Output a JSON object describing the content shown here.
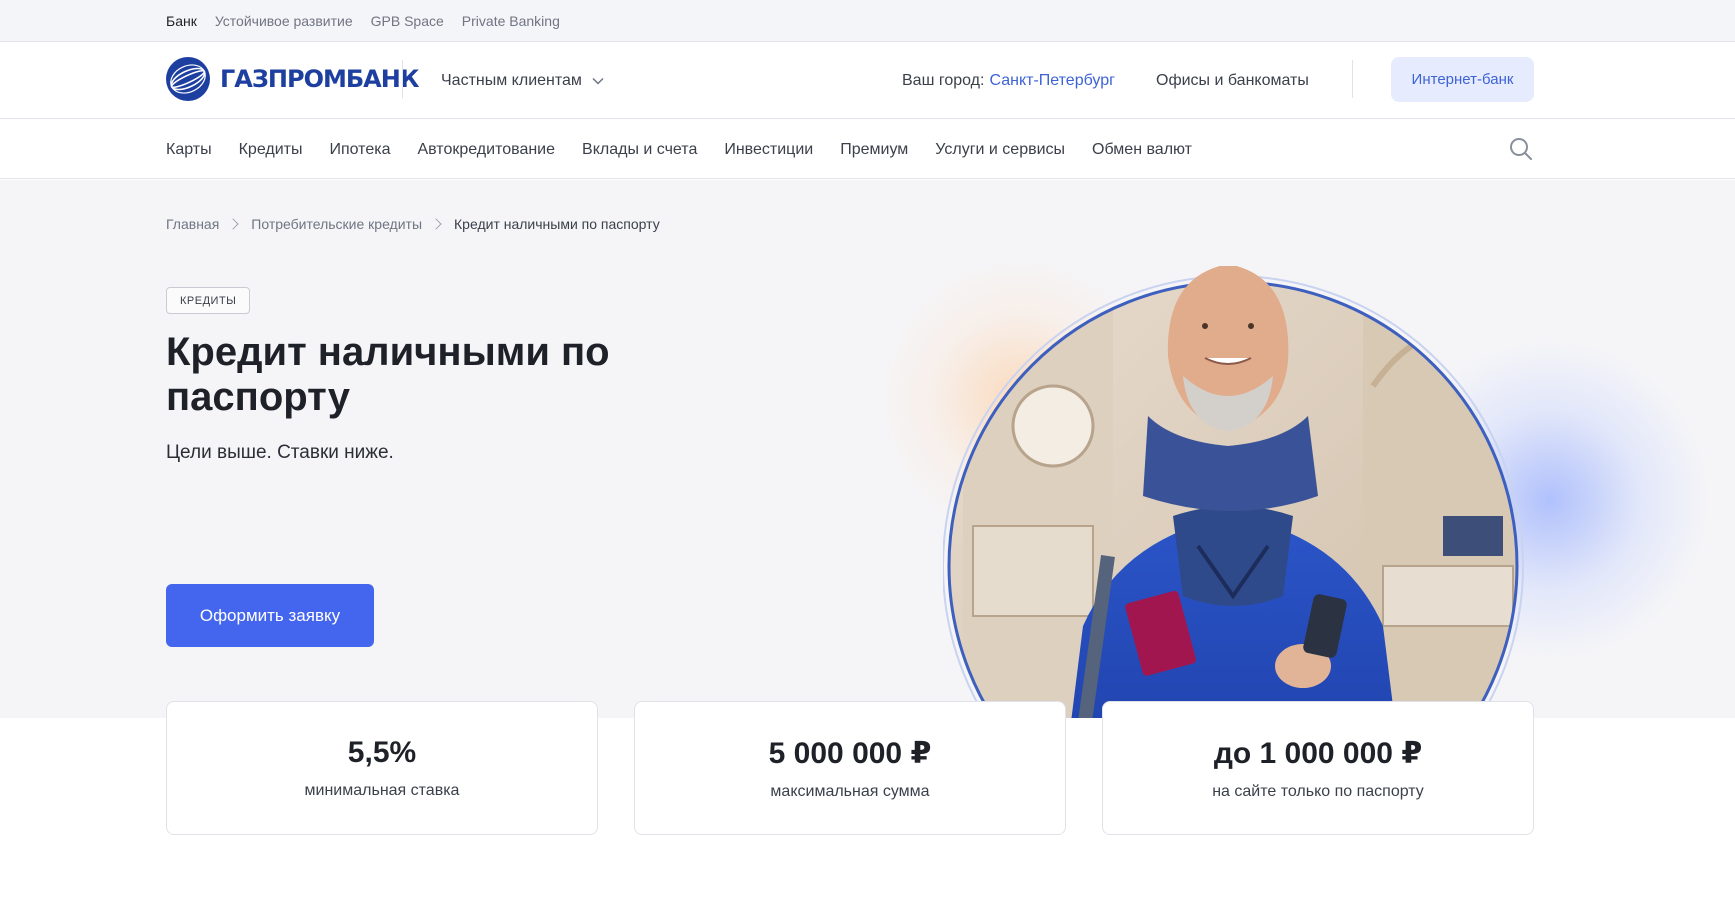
{
  "topbar": {
    "links": [
      "Банк",
      "Устойчивое развитие",
      "GPB Space",
      "Private Banking"
    ]
  },
  "header": {
    "logo_text": "ГАЗПРОМБАНК",
    "clients_label": "Частным клиентам",
    "city_prefix": "Ваш город:",
    "city_name": "Санкт-Петербург",
    "offices_label": "Офисы и банкоматы",
    "internet_bank_label": "Интернет-банк"
  },
  "nav": {
    "items": [
      "Карты",
      "Кредиты",
      "Ипотека",
      "Автокредитование",
      "Вклады и счета",
      "Инвестиции",
      "Премиум",
      "Услуги и сервисы",
      "Обмен валют"
    ]
  },
  "breadcrumb": {
    "items": [
      "Главная",
      "Потребительские кредиты",
      "Кредит наличными по паспорту"
    ]
  },
  "hero": {
    "tag": "КРЕДИТЫ",
    "title": "Кредит наличными по паспорту",
    "subtitle": "Цели выше. Ставки ниже.",
    "cta_label": "Оформить заявку"
  },
  "stats": [
    {
      "value": "5,5%",
      "label": "минимальная ставка"
    },
    {
      "value": "5 000 000 ₽",
      "label": "максимальная сумма"
    },
    {
      "value": "до 1 000 000 ₽",
      "label": "на сайте только по паспорту"
    }
  ],
  "colors": {
    "brand": "#1d3fa0",
    "accent": "#4466ef",
    "link": "#3e63d6",
    "hero_bg": "#f5f5f8"
  }
}
